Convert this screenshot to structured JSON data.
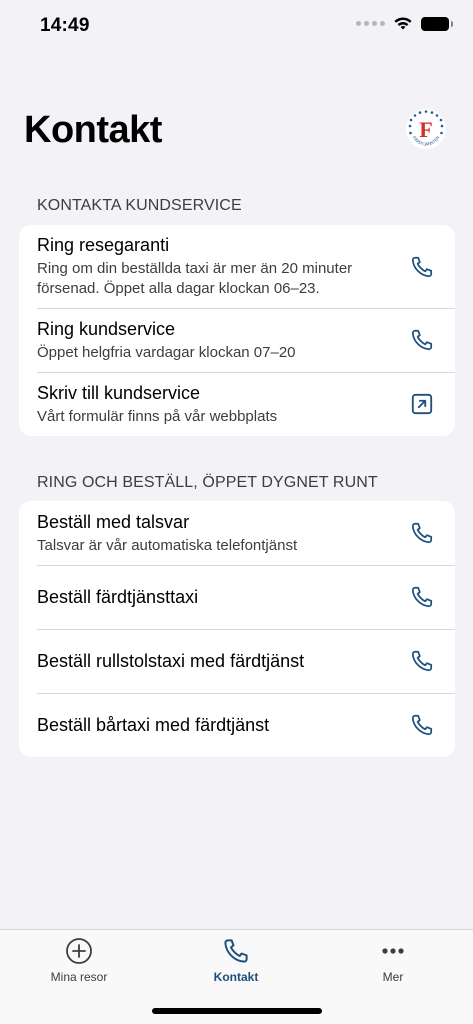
{
  "status_bar": {
    "time": "14:49"
  },
  "header": {
    "title": "Kontakt",
    "logo_letter": "F",
    "logo_text": "FÄRDTJÄNSTEN"
  },
  "sections": [
    {
      "header": "KONTAKTA KUNDSERVICE",
      "rows": [
        {
          "title": "Ring resegaranti",
          "subtitle": "Ring om din beställda taxi är mer än 20 minuter försenad. Öppet alla dagar klockan 06–23.",
          "icon": "phone-icon"
        },
        {
          "title": "Ring kundservice",
          "subtitle": "Öppet helgfria vardagar klockan 07–20",
          "icon": "phone-icon"
        },
        {
          "title": "Skriv till kundservice",
          "subtitle": "Vårt formulär finns på vår webbplats",
          "icon": "external-link-icon"
        }
      ]
    },
    {
      "header": "RING OCH BESTÄLL, ÖPPET DYGNET RUNT",
      "rows": [
        {
          "title": "Beställ med talsvar",
          "subtitle": "Talsvar är vår automatiska telefontjänst",
          "icon": "phone-icon"
        },
        {
          "title": "Beställ färdtjänsttaxi",
          "icon": "phone-icon"
        },
        {
          "title": "Beställ rullstolstaxi med färdtjänst",
          "icon": "phone-icon"
        },
        {
          "title": "Beställ bårtaxi med färdtjänst",
          "icon": "phone-icon"
        }
      ]
    }
  ],
  "tab_bar": [
    {
      "label": "Mina resor",
      "icon": "plus-circle-icon",
      "active": false
    },
    {
      "label": "Kontakt",
      "icon": "phone-icon",
      "active": true
    },
    {
      "label": "Mer",
      "icon": "more-icon",
      "active": false
    }
  ],
  "colors": {
    "accent": "#1f4f7c",
    "background": "#f2f2f7",
    "logo_red": "#d52b2b",
    "logo_blue": "#2a5a9a"
  }
}
